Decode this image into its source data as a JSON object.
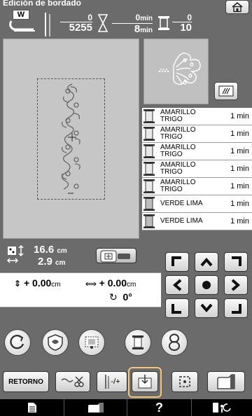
{
  "header": {
    "title": "Edición de bordado",
    "presser_label": "W",
    "stitch_count": {
      "done": "0",
      "total": "5255"
    },
    "time": {
      "done": "0",
      "total": "8",
      "unit": "min"
    },
    "colors": {
      "done": "0",
      "total": "10"
    }
  },
  "thread_list": [
    {
      "name1": "AMARILLO",
      "name2": "TRIGO",
      "time": "1 min",
      "color": "#e9e9e9"
    },
    {
      "name1": "AMARILLO",
      "name2": "TRIGO",
      "time": "1 min",
      "color": "#e9e9e9"
    },
    {
      "name1": "AMARILLO",
      "name2": "TRIGO",
      "time": "1 min",
      "color": "#e9e9e9"
    },
    {
      "name1": "AMARILLO",
      "name2": "TRIGO",
      "time": "1 min",
      "color": "#e9e9e9"
    },
    {
      "name1": "AMARILLO",
      "name2": "TRIGO",
      "time": "1 min",
      "color": "#e9e9e9"
    },
    {
      "name1": "VERDE LIMA",
      "name2": "",
      "time": "1 min",
      "color": "#bdbdbd"
    },
    {
      "name1": "VERDE LIMA",
      "name2": "",
      "time": "1 min",
      "color": "#bdbdbd"
    }
  ],
  "size": {
    "height": "16.6",
    "width": "2.9",
    "unit": "cm"
  },
  "offset": {
    "vertical": "+ 0.00",
    "horizontal": "+ 0.00",
    "unit": "cm",
    "rotation": "0°"
  },
  "buttons": {
    "retorno": "RETORNO",
    "split": "-/+"
  }
}
